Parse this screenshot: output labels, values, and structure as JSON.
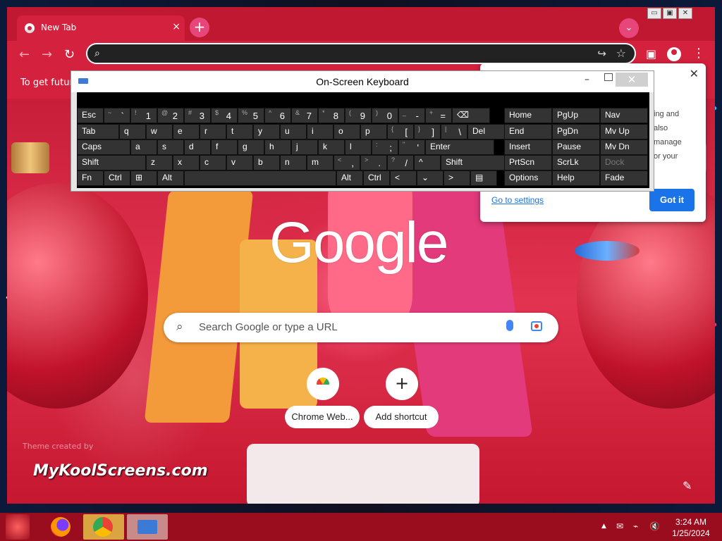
{
  "browser": {
    "tab_title": "New Tab",
    "tab_close": "×",
    "new_tab": "+",
    "tab_search": "⌄",
    "back": "←",
    "forward": "→",
    "reload": "↻",
    "omnibox_value": "",
    "menu": "⋮",
    "infobar_text": "To get future"
  },
  "window_controls": [
    "▭",
    "▣",
    "✕"
  ],
  "ntp": {
    "logo": "Google",
    "search_placeholder": "Search Google or type a URL",
    "shortcuts": [
      {
        "label": "Chrome Web...",
        "icon": "chrome-web-store-icon"
      },
      {
        "label": "Add shortcut",
        "icon": "plus-icon",
        "glyph": "+"
      }
    ],
    "watermark": "MyKoolScreens.com",
    "credits": "Theme created by",
    "customize_icon": "✎"
  },
  "promo": {
    "close": "✕",
    "body_lines": [
      "ing and",
      "also",
      "manage",
      "or your"
    ],
    "link": "Go to settings",
    "button": "Got it"
  },
  "osk": {
    "title": "On-Screen Keyboard",
    "rows": [
      [
        {
          "label": "Esc"
        },
        {
          "sub": "~",
          "main": "`"
        },
        {
          "sub": "!",
          "main": "1"
        },
        {
          "sub": "@",
          "main": "2"
        },
        {
          "sub": "#",
          "main": "3"
        },
        {
          "sub": "$",
          "main": "4"
        },
        {
          "sub": "%",
          "main": "5"
        },
        {
          "sub": "^",
          "main": "6"
        },
        {
          "sub": "&",
          "main": "7"
        },
        {
          "sub": "*",
          "main": "8"
        },
        {
          "sub": "(",
          "main": "9"
        },
        {
          "sub": ")",
          "main": "0"
        },
        {
          "sub": "_",
          "main": "-"
        },
        {
          "sub": "+",
          "main": "="
        },
        {
          "label": "⌫"
        },
        {
          "label": "Home"
        },
        {
          "label": "PgUp"
        },
        {
          "label": "Nav"
        }
      ],
      [
        {
          "label": "Tab"
        },
        {
          "label": "q"
        },
        {
          "label": "w"
        },
        {
          "label": "e"
        },
        {
          "label": "r"
        },
        {
          "label": "t"
        },
        {
          "label": "y"
        },
        {
          "label": "u"
        },
        {
          "label": "i"
        },
        {
          "label": "o"
        },
        {
          "label": "p"
        },
        {
          "sub": "{",
          "main": "["
        },
        {
          "sub": "}",
          "main": "]"
        },
        {
          "sub": "|",
          "main": "\\"
        },
        {
          "label": "Del"
        },
        {
          "label": "End"
        },
        {
          "label": "PgDn"
        },
        {
          "label": "Mv Up"
        }
      ],
      [
        {
          "label": "Caps"
        },
        {
          "label": "a"
        },
        {
          "label": "s"
        },
        {
          "label": "d"
        },
        {
          "label": "f"
        },
        {
          "label": "g"
        },
        {
          "label": "h"
        },
        {
          "label": "j"
        },
        {
          "label": "k"
        },
        {
          "label": "l"
        },
        {
          "sub": ":",
          "main": ";"
        },
        {
          "sub": "\"",
          "main": "'"
        },
        {
          "label": "Enter"
        },
        {
          "label": "Insert"
        },
        {
          "label": "Pause"
        },
        {
          "label": "Mv Dn"
        }
      ],
      [
        {
          "label": "Shift"
        },
        {
          "label": "z"
        },
        {
          "label": "x"
        },
        {
          "label": "c"
        },
        {
          "label": "v"
        },
        {
          "label": "b"
        },
        {
          "label": "n"
        },
        {
          "label": "m"
        },
        {
          "sub": "<",
          "main": ","
        },
        {
          "sub": ">",
          "main": "."
        },
        {
          "sub": "?",
          "main": "/"
        },
        {
          "label": "^"
        },
        {
          "label": "Shift"
        },
        {
          "label": "PrtScn"
        },
        {
          "label": "ScrLk"
        },
        {
          "label": "Dock",
          "dim": true
        }
      ],
      [
        {
          "label": "Fn"
        },
        {
          "label": "Ctrl"
        },
        {
          "label": "⊞"
        },
        {
          "label": "Alt"
        },
        {
          "label": ""
        },
        {
          "label": "Alt"
        },
        {
          "label": "Ctrl"
        },
        {
          "label": "<"
        },
        {
          "label": "⌄"
        },
        {
          "label": ">"
        },
        {
          "label": "▤"
        },
        {
          "label": "Options"
        },
        {
          "label": "Help"
        },
        {
          "label": "Fade"
        }
      ]
    ]
  },
  "taskbar": {
    "clock_time": "3:24 AM",
    "clock_date": "1/25/2024",
    "tray_up": "▲"
  }
}
